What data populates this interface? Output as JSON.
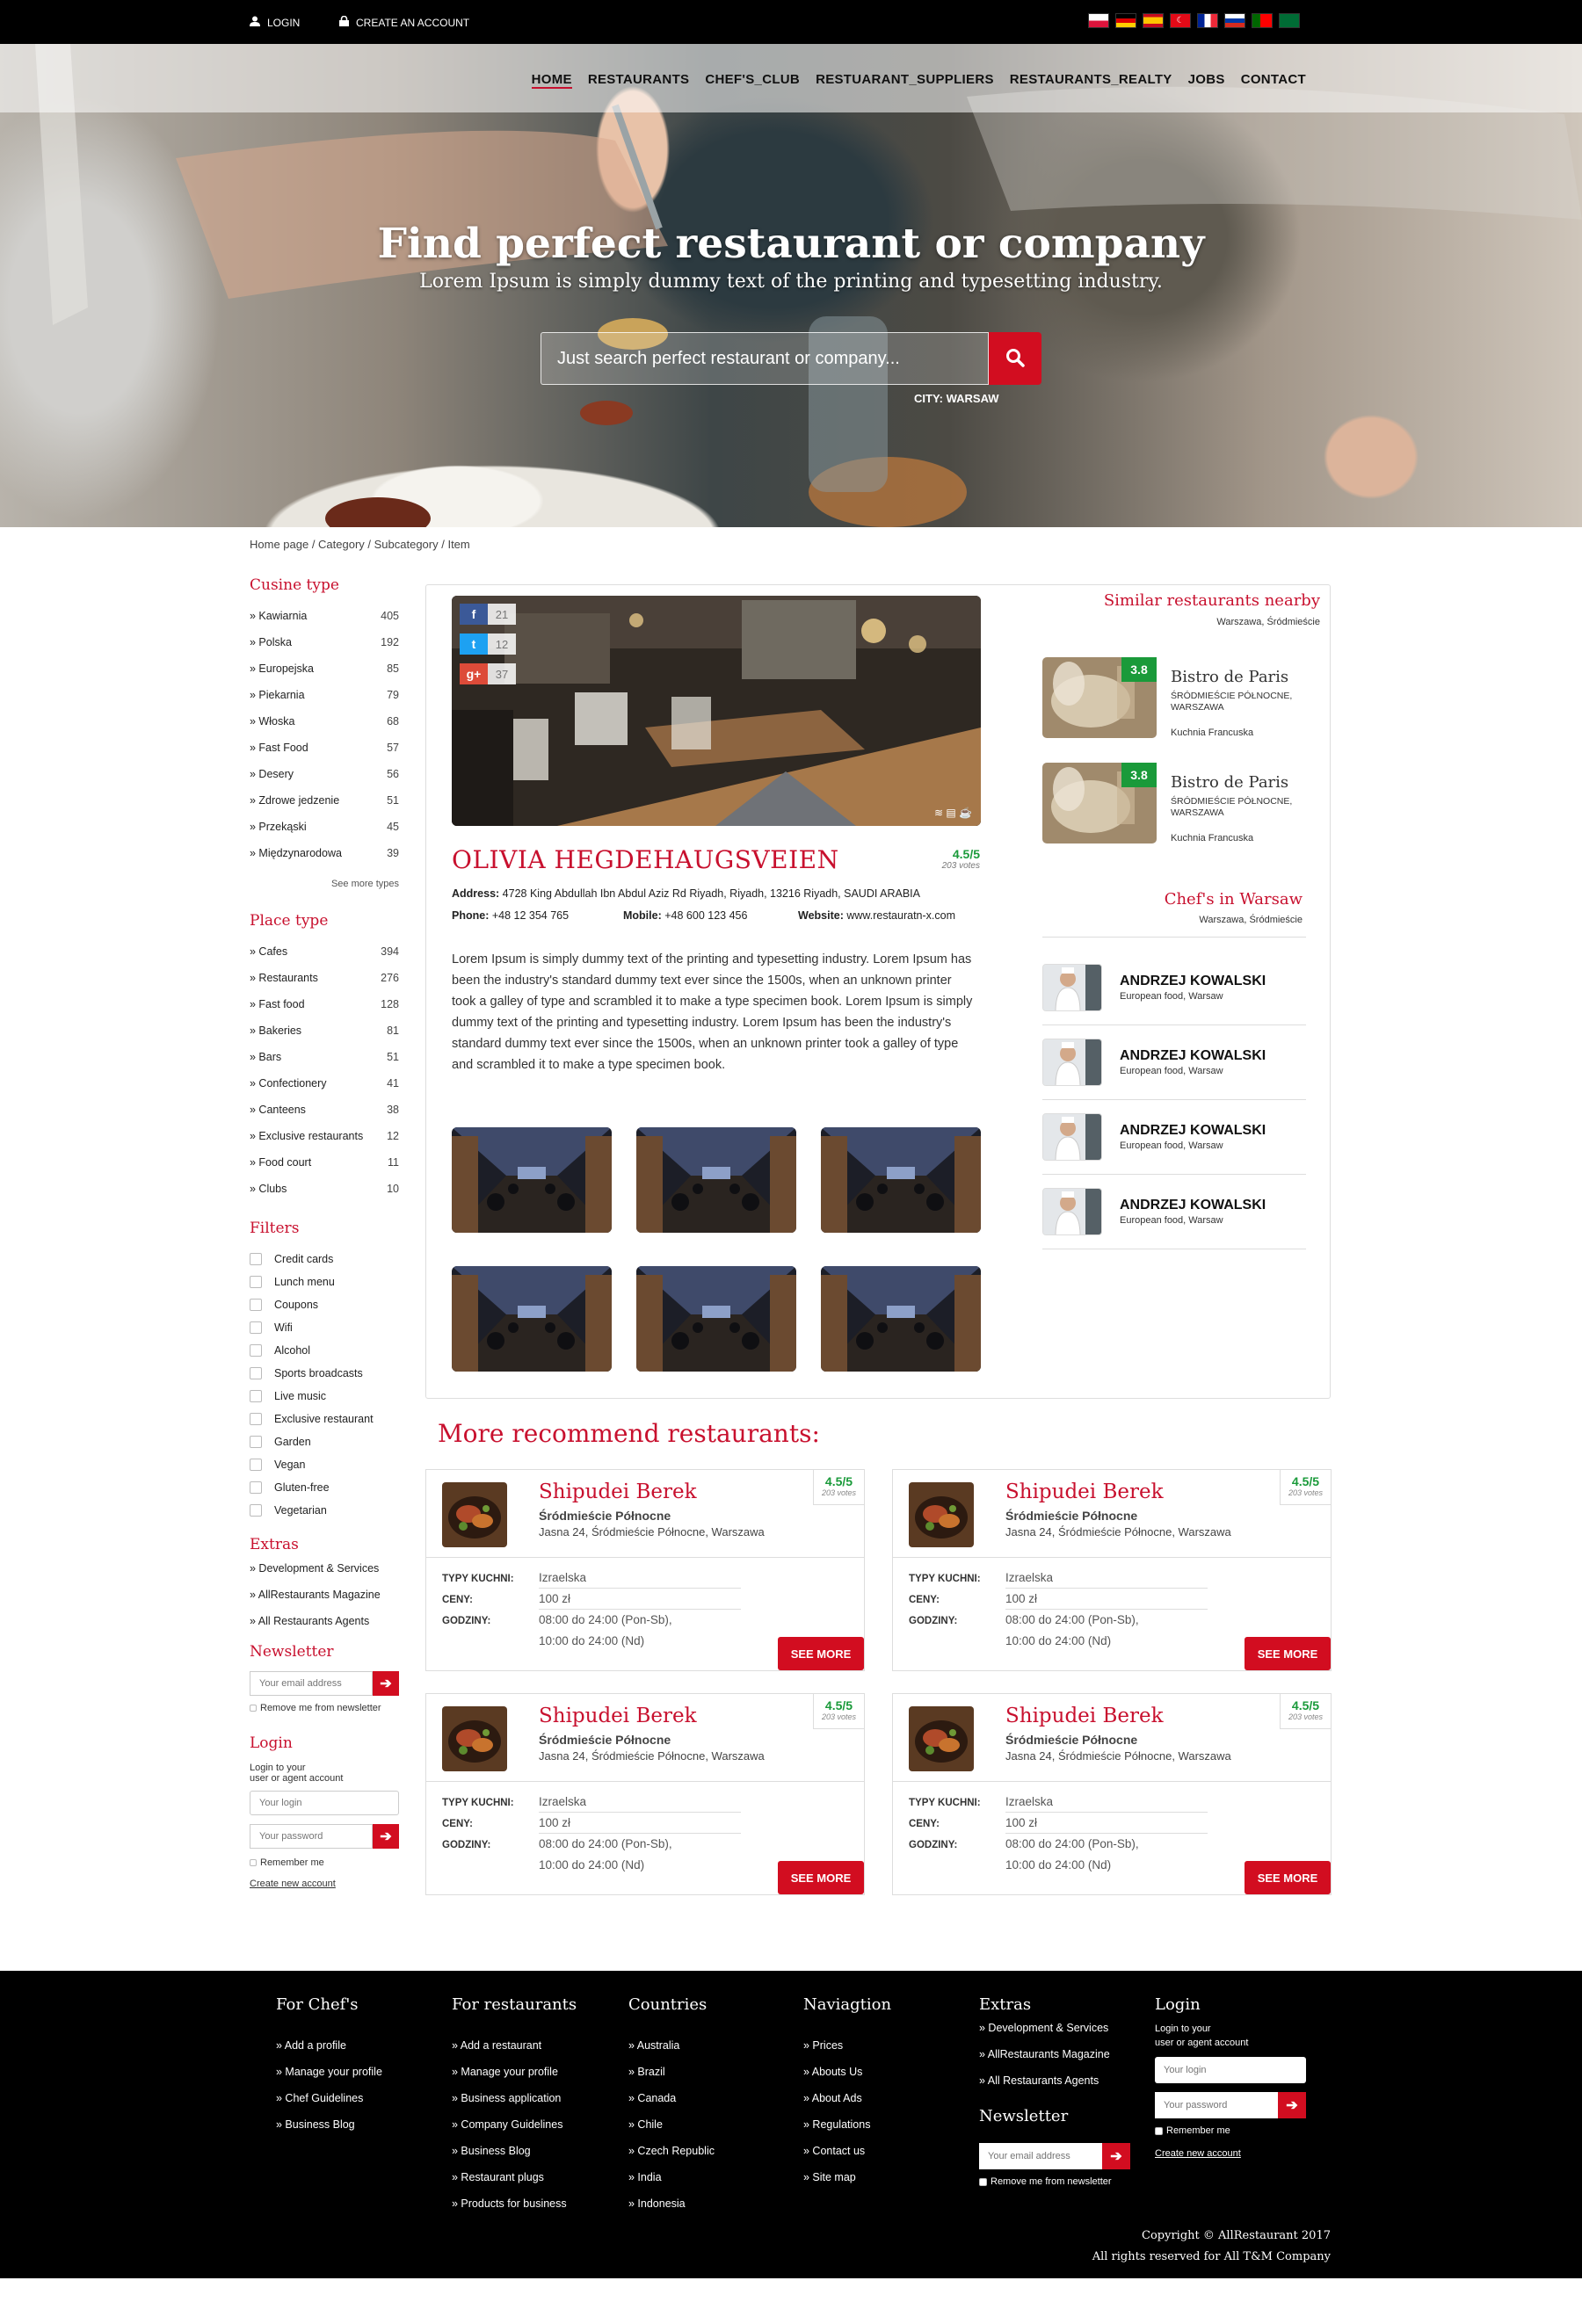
{
  "topbar": {
    "login": "LOGIN",
    "create": "CREATE AN ACCOUNT",
    "flags": [
      "pl",
      "de",
      "es",
      "tr",
      "fr",
      "ru",
      "pt",
      "sa"
    ]
  },
  "nav": [
    "HOME",
    "RESTAURANTS",
    "CHEF'S_CLUB",
    "RESTUARANT_SUPPLIERS",
    "RESTAURANTS_REALTY",
    "JOBS",
    "CONTACT"
  ],
  "hero": {
    "title": "Find perfect restaurant or company",
    "subtitle": "Lorem Ipsum is simply dummy text of the printing and typesetting industry.",
    "search_placeholder": "Just search perfect restaurant or company...",
    "city": "CITY: WARSAW"
  },
  "breadcrumb": "Home page / Category / Subcategory / Item",
  "sidebar": {
    "cuisine_title": "Cusine type",
    "cuisine": [
      {
        "l": "» Kawiarnia",
        "c": "405"
      },
      {
        "l": "» Polska",
        "c": "192"
      },
      {
        "l": "» Europejska",
        "c": "85"
      },
      {
        "l": "» Piekarnia",
        "c": "79"
      },
      {
        "l": "» Włoska",
        "c": "68"
      },
      {
        "l": "» Fast Food",
        "c": "57"
      },
      {
        "l": "» Desery",
        "c": "56"
      },
      {
        "l": "» Zdrowe jedzenie",
        "c": "51"
      },
      {
        "l": "» Przekąski",
        "c": "45"
      },
      {
        "l": "» Międzynarodowa",
        "c": "39"
      }
    ],
    "see_more": "See more types",
    "place_title": "Place type",
    "place": [
      {
        "l": "» Cafes",
        "c": "394"
      },
      {
        "l": "» Restaurants",
        "c": "276"
      },
      {
        "l": "» Fast food",
        "c": "128"
      },
      {
        "l": "» Bakeries",
        "c": "81"
      },
      {
        "l": "» Bars",
        "c": "51"
      },
      {
        "l": "» Confectionery",
        "c": "41"
      },
      {
        "l": "» Canteens",
        "c": "38"
      },
      {
        "l": "» Exclusive restaurants",
        "c": "12"
      },
      {
        "l": "» Food court",
        "c": "11"
      },
      {
        "l": "» Clubs",
        "c": "10"
      }
    ],
    "filters_title": "Filters",
    "filters": [
      "Credit cards",
      "Lunch menu",
      "Coupons",
      "Wifi",
      "Alcohol",
      "Sports broadcasts",
      "Live music",
      "Exclusive restaurant",
      "Garden",
      "Vegan",
      "Gluten-free",
      "Vegetarian"
    ],
    "extras_title": "Extras",
    "extras": [
      "» Development & Services",
      "» AllRestaurants Magazine",
      "» All Restaurants Agents"
    ],
    "newsletter_title": "Newsletter",
    "newsletter_placeholder": "Your email address",
    "newsletter_remove": "Remove me from newsletter",
    "login_title": "Login",
    "login_text1": "Login to your",
    "login_text2": "user or agent account",
    "login_placeholder": "Your login",
    "password_placeholder": "Your password",
    "remember": "Remember me",
    "create": "Create new account"
  },
  "restaurant": {
    "social": [
      {
        "icon": "f",
        "count": "21",
        "color": "#3b5998"
      },
      {
        "icon": "t",
        "count": "12",
        "color": "#1da1f2"
      },
      {
        "icon": "g+",
        "count": "37",
        "color": "#dd4b39"
      }
    ],
    "name": "OLIVIA HEGDEHAUGSVEIEN",
    "rating": "4.5/5",
    "votes": "203 votes",
    "address_label": "Address:",
    "address": "4728 King Abdullah Ibn Abdul Aziz Rd Riyadh, Riyadh, 13216 Riyadh, SAUDI ARABIA",
    "phone_label": "Phone:",
    "phone": "+48 12 354 765",
    "mobile_label": "Mobile:",
    "mobile": "+48 600 123 456",
    "website_label": "Website:",
    "website": "www.restauratn-x.com",
    "description": "Lorem Ipsum is simply dummy text of the printing and typesetting industry. Lorem Ipsum has been the industry's standard dummy text ever since the 1500s, when an unknown printer took a galley of type and scrambled it to make a type specimen book. Lorem Ipsum is simply dummy text of the printing and typesetting industry. Lorem Ipsum has been the industry's standard dummy text ever since the 1500s, when an unknown printer took a galley of type and scrambled it to make a type specimen book."
  },
  "similar": {
    "title": "Similar restaurants nearby",
    "sub": "Warszawa, Śródmieście",
    "items": [
      {
        "rating": "3.8",
        "name": "Bistro de Paris",
        "addr": "ŚRÓDMIEŚCIE PÓŁNOCNE, WARSZAWA",
        "kitchen": "Kuchnia Francuska"
      },
      {
        "rating": "3.8",
        "name": "Bistro de Paris",
        "addr": "ŚRÓDMIEŚCIE PÓŁNOCNE, WARSZAWA",
        "kitchen": "Kuchnia Francuska"
      }
    ]
  },
  "chefs": {
    "title": "Chef's in Warsaw",
    "sub": "Warszawa, Śródmieście",
    "items": [
      {
        "name": "ANDRZEJ KOWALSKI",
        "desc": "European food, Warsaw"
      },
      {
        "name": "ANDRZEJ KOWALSKI",
        "desc": "European food, Warsaw"
      },
      {
        "name": "ANDRZEJ KOWALSKI",
        "desc": "European food, Warsaw"
      },
      {
        "name": "ANDRZEJ KOWALSKI",
        "desc": "European food, Warsaw"
      }
    ]
  },
  "recommend": {
    "title": "More recommend restaurants:",
    "labels": {
      "kitchen": "TYPY KUCHNI:",
      "price": "CENY:",
      "hours": "GODZINY:",
      "button": "SEE MORE"
    },
    "items": [
      {
        "name": "Shipudei Berek",
        "district": "Śródmieście Północne",
        "address": "Jasna 24, Śródmieście Północne, Warszawa",
        "rating": "4.5/5",
        "votes": "203 votes",
        "kitchen": "Izraelska",
        "price": "100 zł",
        "hours1": "08:00 do 24:00 (Pon-Sb),",
        "hours2": "10:00 do 24:00 (Nd)"
      },
      {
        "name": "Shipudei Berek",
        "district": "Śródmieście Północne",
        "address": "Jasna 24, Śródmieście Północne, Warszawa",
        "rating": "4.5/5",
        "votes": "203 votes",
        "kitchen": "Izraelska",
        "price": "100 zł",
        "hours1": "08:00 do 24:00 (Pon-Sb),",
        "hours2": "10:00 do 24:00 (Nd)"
      },
      {
        "name": "Shipudei Berek",
        "district": "Śródmieście Północne",
        "address": "Jasna 24, Śródmieście Północne, Warszawa",
        "rating": "4.5/5",
        "votes": "203 votes",
        "kitchen": "Izraelska",
        "price": "100 zł",
        "hours1": "08:00 do 24:00 (Pon-Sb),",
        "hours2": "10:00 do 24:00 (Nd)"
      },
      {
        "name": "Shipudei Berek",
        "district": "Śródmieście Północne",
        "address": "Jasna 24, Śródmieście Północne, Warszawa",
        "rating": "4.5/5",
        "votes": "203 votes",
        "kitchen": "Izraelska",
        "price": "100 zł",
        "hours1": "08:00 do 24:00 (Pon-Sb),",
        "hours2": "10:00 do 24:00 (Nd)"
      }
    ]
  },
  "footer": {
    "chefs_title": "For Chef's",
    "chefs": [
      "» Add a profile",
      "» Manage your profile",
      "» Chef Guidelines",
      "» Business Blog"
    ],
    "rest_title": "For restaurants",
    "rest": [
      "» Add a restaurant",
      "» Manage your profile",
      "» Business application",
      "» Company Guidelines",
      "» Business Blog",
      "» Restaurant plugs",
      "» Products for business"
    ],
    "countries_title": "Countries",
    "countries": [
      "» Australia",
      "» Brazil",
      "» Canada",
      "» Chile",
      "» Czech Republic",
      "» India",
      "» Indonesia"
    ],
    "nav_title": "Naviagtion",
    "nav": [
      "» Prices",
      "» Abouts Us",
      "» About Ads",
      "» Regulations",
      "» Contact us",
      "» Site map"
    ],
    "extras_title": "Extras",
    "extras": [
      "» Development & Services",
      "» AllRestaurants Magazine",
      "» All Restaurants Agents"
    ],
    "newsletter_title": "Newsletter",
    "newsletter_placeholder": "Your email address",
    "newsletter_remove": "Remove me from newsletter",
    "login_title": "Login",
    "login_text1": "Login to your",
    "login_text2": "user or agent account",
    "login_placeholder": "Your login",
    "password_placeholder": "Your password",
    "remember": "Remember me",
    "create": "Create new account",
    "copyright": "Copyright © AllRestaurant 2017",
    "rights": "All rights reserved for All T&M Company"
  }
}
